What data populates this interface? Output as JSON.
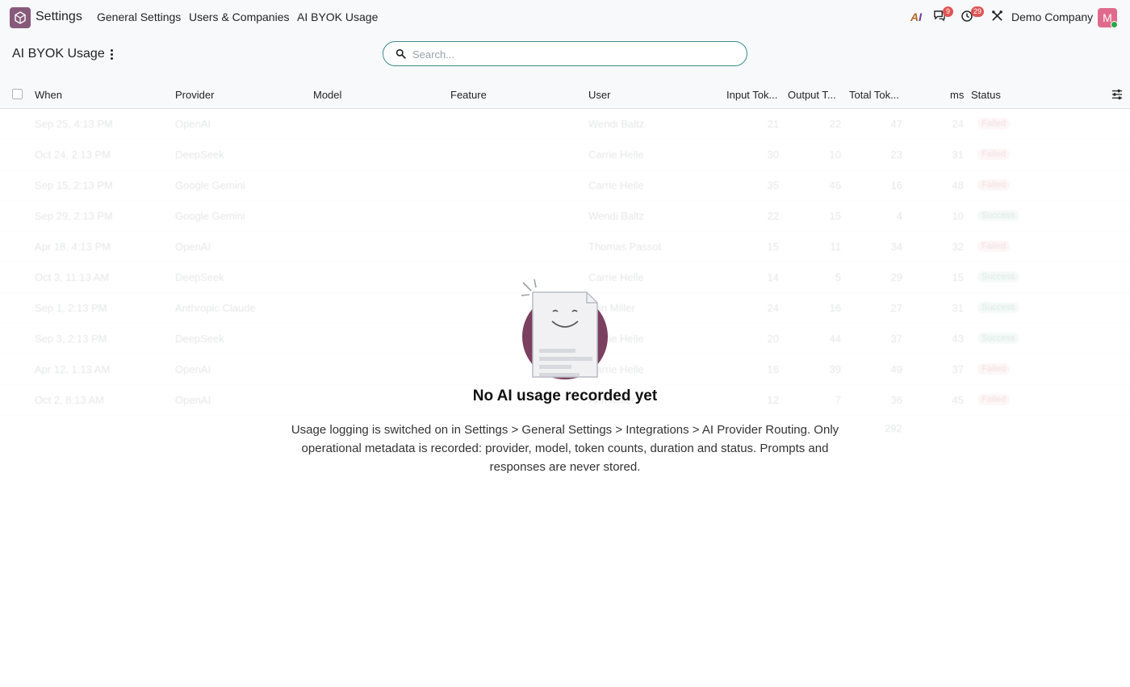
{
  "navbar": {
    "app_name": "Settings",
    "menus": [
      "General Settings",
      "Users & Companies",
      "AI BYOK Usage"
    ],
    "messages_badge": "9",
    "activities_badge": "29",
    "company": "Demo Company",
    "avatar_letter": "M"
  },
  "control_panel": {
    "title": "AI BYOK Usage",
    "search_placeholder": "Search..."
  },
  "table": {
    "columns": [
      "When",
      "Provider",
      "Model",
      "Feature",
      "User",
      "Input Tok...",
      "Output T...",
      "Total Tok...",
      "ms",
      "Status"
    ],
    "ghost_rows": [
      {
        "when": "Sep 25, 4:13 PM",
        "provider": "OpenAI",
        "user": "Wendi Baltz",
        "input": "21",
        "output": "22",
        "total": "47",
        "ms": "24",
        "status": "Failed"
      },
      {
        "when": "Oct 24, 2:13 PM",
        "provider": "DeepSeek",
        "user": "Carrie Helle",
        "input": "30",
        "output": "10",
        "total": "23",
        "ms": "31",
        "status": "Failed"
      },
      {
        "when": "Sep 15, 2:13 PM",
        "provider": "Google Gemini",
        "user": "Carrie Helle",
        "input": "35",
        "output": "46",
        "total": "16",
        "ms": "48",
        "status": "Failed"
      },
      {
        "when": "Sep 29, 2:13 PM",
        "provider": "Google Gemini",
        "user": "Wendi Baltz",
        "input": "22",
        "output": "15",
        "total": "4",
        "ms": "10",
        "status": "Success"
      },
      {
        "when": "Apr 18, 4:13 PM",
        "provider": "OpenAI",
        "user": "Thomas Passot",
        "input": "15",
        "output": "11",
        "total": "34",
        "ms": "32",
        "status": "Failed"
      },
      {
        "when": "Oct 3, 11:13 AM",
        "provider": "DeepSeek",
        "user": "Carrie Helle",
        "input": "14",
        "output": "5",
        "total": "29",
        "ms": "15",
        "status": "Success"
      },
      {
        "when": "Sep 1, 2:13 PM",
        "provider": "Anthropic Claude",
        "user": "Ann Miller",
        "input": "24",
        "output": "16",
        "total": "27",
        "ms": "31",
        "status": "Success"
      },
      {
        "when": "Sep 3, 2:13 PM",
        "provider": "DeepSeek",
        "user": "Carrie Helle",
        "input": "20",
        "output": "44",
        "total": "37",
        "ms": "43",
        "status": "Success"
      },
      {
        "when": "Apr 12, 1:13 AM",
        "provider": "OpenAI",
        "user": "Carrie Helle",
        "input": "16",
        "output": "39",
        "total": "49",
        "ms": "37",
        "status": "Failed"
      },
      {
        "when": "Oct 2, 8:13 AM",
        "provider": "OpenAI",
        "user": "Ann Miller",
        "input": "12",
        "output": "7",
        "total": "36",
        "ms": "45",
        "status": "Failed"
      }
    ],
    "ghost_total": "292"
  },
  "empty_state": {
    "title": "No AI usage recorded yet",
    "text": "Usage logging is switched on in Settings > General Settings > Integrations > AI Provider Routing. Only operational metadata is recorded: provider, model, token counts, duration and status. Prompts and responses are never stored."
  },
  "colors": {
    "brand": "#875a7b",
    "search_border": "#3a8e8c",
    "badge": "#e05454",
    "avatar": "#e06a8c"
  }
}
